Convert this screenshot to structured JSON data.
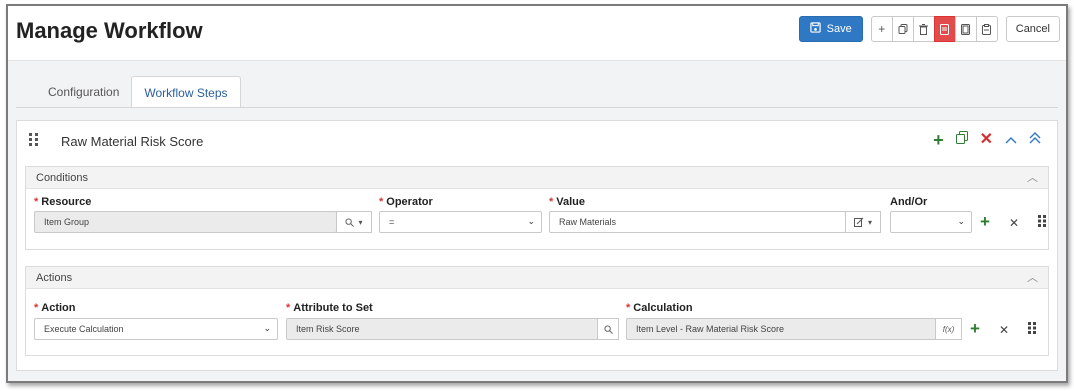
{
  "header": {
    "title": "Manage Workflow",
    "save_label": "Save",
    "cancel_label": "Cancel"
  },
  "tabs": [
    {
      "label": "Configuration",
      "active": false
    },
    {
      "label": "Workflow Steps",
      "active": true
    }
  ],
  "step": {
    "title": "Raw Material Risk Score"
  },
  "conditions": {
    "title": "Conditions",
    "labels": {
      "resource": "Resource",
      "operator": "Operator",
      "value": "Value",
      "andor": "And/Or"
    },
    "row": {
      "resource": "Item Group",
      "operator": "=",
      "value": "Raw Materials",
      "andor": ""
    }
  },
  "actions": {
    "title": "Actions",
    "labels": {
      "action": "Action",
      "attribute": "Attribute to Set",
      "calculation": "Calculation"
    },
    "row": {
      "action": "Execute Calculation",
      "attribute": "Item Risk Score",
      "calculation": "Item Level - Raw Material Risk Score",
      "fx": "f(x)"
    }
  },
  "colors": {
    "primary": "#2f78c4",
    "danger": "#e14b4b",
    "add_green": "#2e7d32",
    "remove_red": "#d32f2f"
  }
}
